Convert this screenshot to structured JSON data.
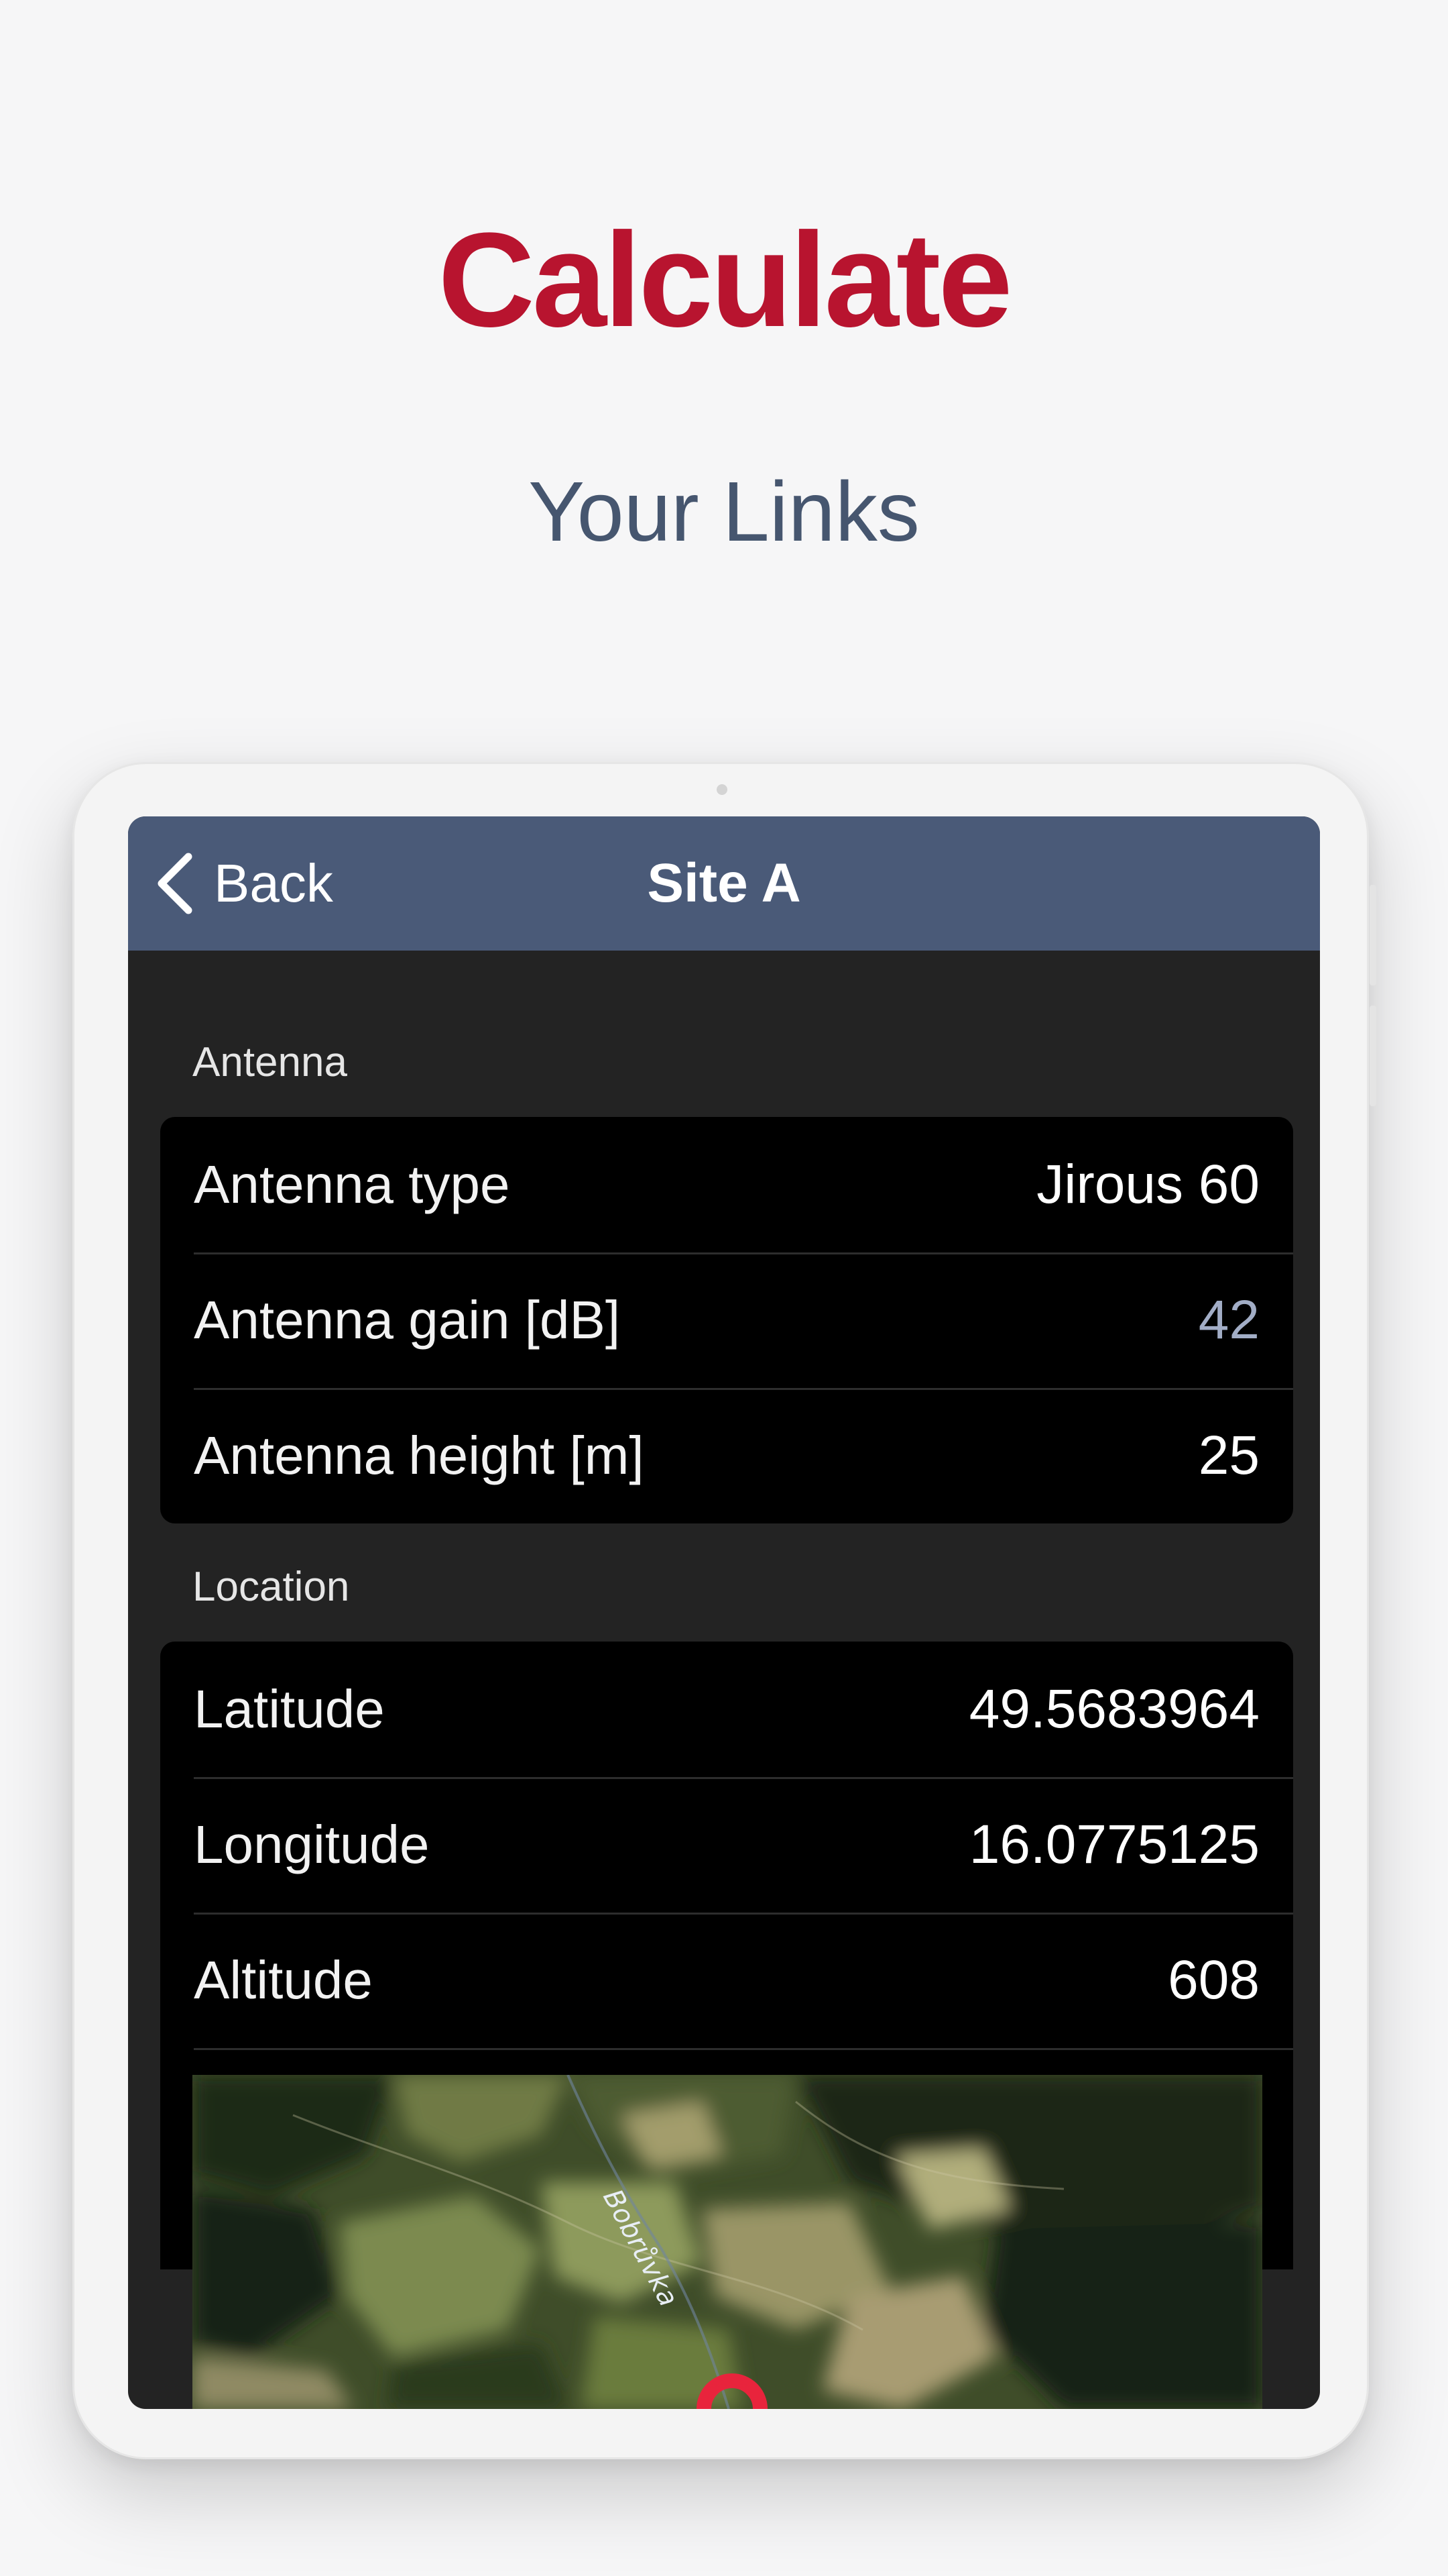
{
  "promo": {
    "headline": "Calculate",
    "subheadline": "Your Links"
  },
  "nav": {
    "back_label": "Back",
    "title": "Site A"
  },
  "antenna_section": {
    "header": "Antenna",
    "rows": [
      {
        "label": "Antenna type",
        "value": "Jirous 60"
      },
      {
        "label": "Antenna gain [dB]",
        "value": "42"
      },
      {
        "label": "Antenna height [m]",
        "value": "25"
      }
    ]
  },
  "location_section": {
    "header": "Location",
    "rows": [
      {
        "label": "Latitude",
        "value": "49.5683964"
      },
      {
        "label": "Longitude",
        "value": "16.0775125"
      },
      {
        "label": "Altitude",
        "value": "608"
      }
    ]
  },
  "map": {
    "river_label": "Bobrůvka",
    "marker_color": "#e8243c"
  },
  "colors": {
    "accent": "#b8142f",
    "nav_bar": "#4a5a78",
    "muted_value": "#a2adc6"
  },
  "icons": {
    "back": "chevron-left-icon",
    "marker": "map-pin-icon"
  }
}
